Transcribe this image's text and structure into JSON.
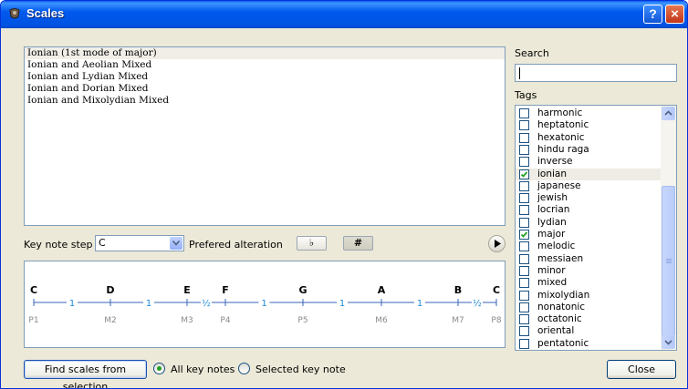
{
  "window": {
    "title": "Scales"
  },
  "title_buttons": {
    "help": "?",
    "close": "×"
  },
  "scales_list": [
    "Ionian (1st mode of major)",
    "Ionian and Aeolian Mixed",
    "Ionian and Lydian Mixed",
    "Ionian and Dorian Mixed",
    "Ionian and Mixolydian Mixed"
  ],
  "key_note": {
    "label": "Key note step",
    "value": "C"
  },
  "alteration": {
    "label": "Prefered alteration",
    "flat": "♭",
    "sharp": "#"
  },
  "staff": {
    "notes": [
      "C",
      "D",
      "E",
      "F",
      "G",
      "A",
      "B",
      "C"
    ],
    "steps": [
      "1",
      "1",
      "½",
      "1",
      "1",
      "1",
      "½"
    ],
    "intervals": [
      "P1",
      "M2",
      "M3",
      "P4",
      "P5",
      "M6",
      "M7",
      "P8"
    ]
  },
  "search": {
    "label": "Search",
    "value": ""
  },
  "tags": {
    "label": "Tags",
    "items": [
      {
        "label": "harmonic",
        "checked": false
      },
      {
        "label": "heptatonic",
        "checked": false
      },
      {
        "label": "hexatonic",
        "checked": false
      },
      {
        "label": "hindu raga",
        "checked": false
      },
      {
        "label": "inverse",
        "checked": false
      },
      {
        "label": "ionian",
        "checked": true
      },
      {
        "label": "japanese",
        "checked": false
      },
      {
        "label": "jewish",
        "checked": false
      },
      {
        "label": "locrian",
        "checked": false
      },
      {
        "label": "lydian",
        "checked": false
      },
      {
        "label": "major",
        "checked": true
      },
      {
        "label": "melodic",
        "checked": false
      },
      {
        "label": "messiaen",
        "checked": false
      },
      {
        "label": "minor",
        "checked": false
      },
      {
        "label": "mixed",
        "checked": false
      },
      {
        "label": "mixolydian",
        "checked": false
      },
      {
        "label": "nonatonic",
        "checked": false
      },
      {
        "label": "octatonic",
        "checked": false
      },
      {
        "label": "oriental",
        "checked": false
      },
      {
        "label": "pentatonic",
        "checked": false
      }
    ]
  },
  "footer": {
    "find_button": "Find scales from selection",
    "radio_all": "All key notes",
    "radio_selected": "Selected key note",
    "selected_option": "all",
    "close_button": "Close"
  },
  "colors": {
    "titlebar": "#0054e3",
    "dialog_bg": "#ece9d8",
    "staff_line": "#3a66b8",
    "step_text": "#1a8ad8",
    "check": "#21a121"
  }
}
